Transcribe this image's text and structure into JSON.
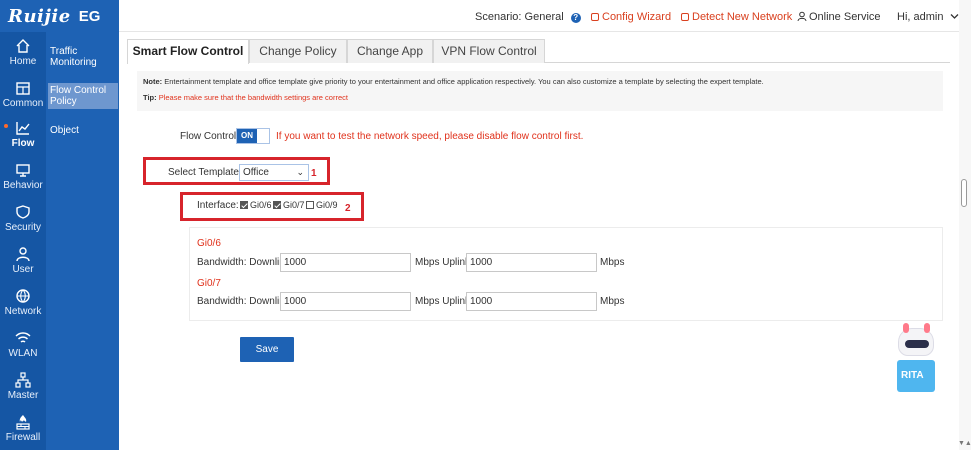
{
  "brand": {
    "name": "Ruijie",
    "product": "EG"
  },
  "nav": [
    {
      "label": "Home",
      "icon": "home-icon"
    },
    {
      "label": "Common",
      "icon": "calendar-icon"
    },
    {
      "label": "Flow",
      "icon": "chart-icon",
      "active": true
    },
    {
      "label": "Behavior",
      "icon": "monitor-icon"
    },
    {
      "label": "Security",
      "icon": "shield-icon"
    },
    {
      "label": "User",
      "icon": "user-icon"
    },
    {
      "label": "Network",
      "icon": "globe-icon"
    },
    {
      "label": "WLAN",
      "icon": "wifi-icon"
    },
    {
      "label": "Master",
      "icon": "sitemap-icon"
    },
    {
      "label": "Firewall",
      "icon": "firewall-icon"
    }
  ],
  "subnav": [
    {
      "label_line1": "Traffic",
      "label_line2": "Monitoring"
    },
    {
      "label_line1": "Flow Control",
      "label_line2": "Policy",
      "active": true
    },
    {
      "label_line1": "Object",
      "label_line2": ""
    }
  ],
  "header": {
    "scenario_label": "Scenario:",
    "scenario_value": "General",
    "config_wizard": "Config Wizard",
    "detect_network": "Detect New Network",
    "online_service": "Online Service",
    "user_greeting": "Hi, admin"
  },
  "tabs": [
    "Smart Flow Control",
    "Change Policy",
    "Change App",
    "VPN Flow Control"
  ],
  "notice": {
    "note_label": "Note:",
    "note_text": " Entertainment template and office template give priority to your entertainment and office application respectively. You can also customize a template by selecting the expert template.",
    "tip_label": "Tip:",
    "tip_text": " Please make sure that the bandwidth settings are correct"
  },
  "flow_control": {
    "label": "Flow Control:",
    "toggle": "ON",
    "warning": "If you want to test the network speed, please disable flow control first."
  },
  "template": {
    "label": "Select Template:",
    "value": "Office",
    "marker": "1"
  },
  "interface": {
    "label": "Interface:",
    "options": [
      {
        "name": "Gi0/6",
        "checked": true
      },
      {
        "name": "Gi0/7",
        "checked": true
      },
      {
        "name": "Gi0/9",
        "checked": false
      }
    ],
    "marker": "2"
  },
  "bandwidth": [
    {
      "name": "Gi0/6",
      "label": "Bandwidth: Downlink",
      "downlink": "1000",
      "mid": "Mbps Uplink",
      "uplink": "1000",
      "unit": "Mbps"
    },
    {
      "name": "Gi0/7",
      "label": "Bandwidth: Downlink",
      "downlink": "1000",
      "mid": "Mbps Uplink",
      "uplink": "1000",
      "unit": "Mbps"
    }
  ],
  "save_label": "Save",
  "assistant_label": "RITA",
  "colors": {
    "primary": "#1e62b4",
    "accent_red": "#d7242b",
    "warning": "#e0321c"
  }
}
